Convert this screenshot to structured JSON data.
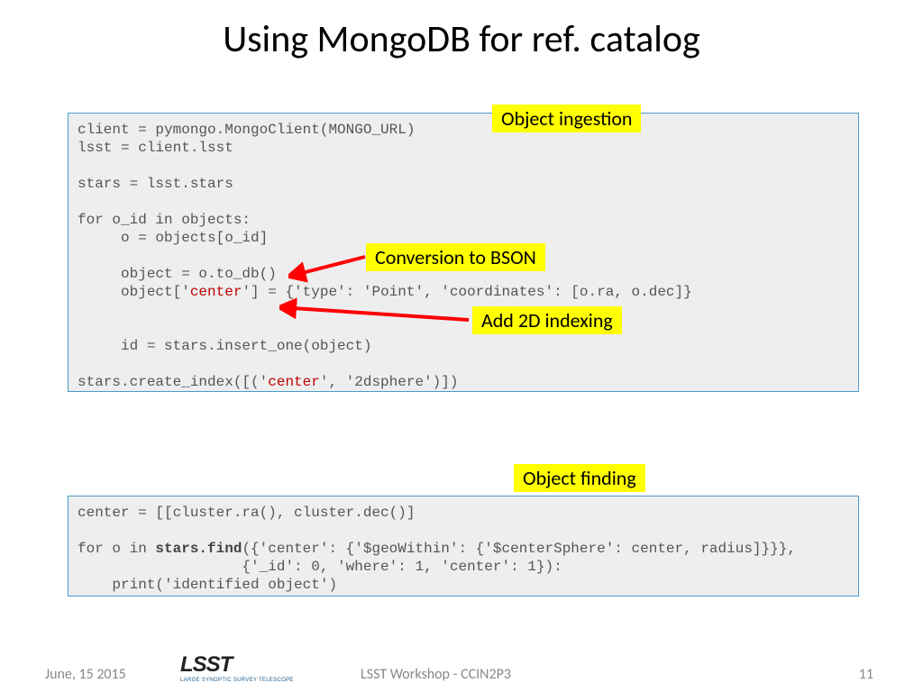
{
  "title": "Using MongoDB for ref. catalog",
  "code1": {
    "l1a": "client = pymongo.MongoClient(MONGO_URL)",
    "l1b": "lsst = client.lsst",
    "l2": "stars = lsst.stars",
    "l3a": "for o_id in objects:",
    "l3b": "     o = objects[o_id]",
    "l4": "     object = o.to_db()",
    "l5a": "     object['",
    "l5b": "center",
    "l5c": "'] = {'type': 'Point', 'coordinates': [o.ra, o.dec]}",
    "l6": "     id = stars.insert_one(object)",
    "l7a": "stars.create_index([('",
    "l7b": "center",
    "l7c": "', '2dsphere')])"
  },
  "code2": {
    "l1": "center = [[cluster.ra(), cluster.dec()]",
    "l2a": "for o in ",
    "l2b": "stars.find",
    "l2c": "({'center': {'$geoWithin': {'$centerSphere': center, radius]}}},",
    "l3": "                   {'_id': 0, 'where': 1, 'center': 1}):",
    "l4": "    print('identified object')"
  },
  "tags": {
    "ingestion": "Object ingestion",
    "bson": "Conversion to BSON",
    "indexing": "Add 2D indexing",
    "finding": "Object finding"
  },
  "footer": {
    "date": "June, 15 2015",
    "center": "LSST Workshop - CCIN2P3",
    "page": "11"
  },
  "logo": {
    "main": "LSST",
    "sub": "LARGE SYNOPTIC SURVEY TELESCOPE"
  }
}
